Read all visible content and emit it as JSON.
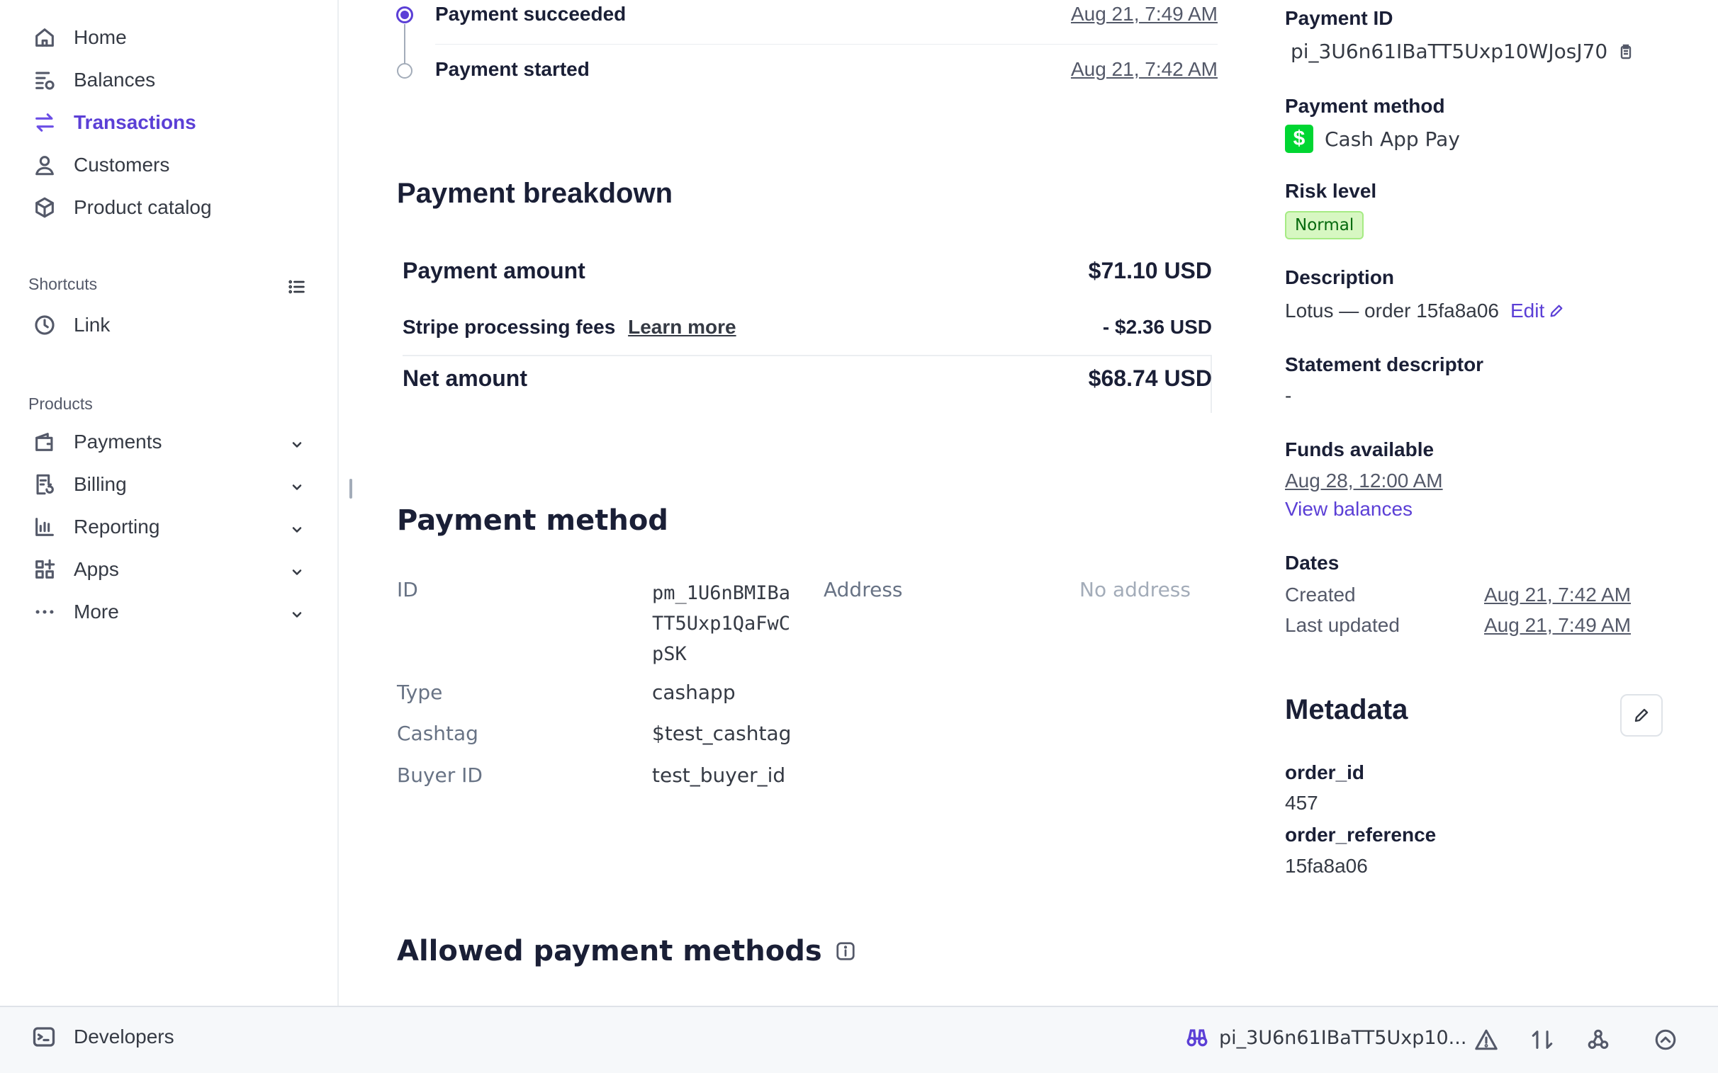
{
  "sidebar": {
    "nav": [
      {
        "label": "Home",
        "icon": "home-icon"
      },
      {
        "label": "Balances",
        "icon": "balances-icon"
      },
      {
        "label": "Transactions",
        "icon": "transactions-icon",
        "active": true
      },
      {
        "label": "Customers",
        "icon": "customers-icon"
      },
      {
        "label": "Product catalog",
        "icon": "product-catalog-icon"
      }
    ],
    "shortcuts_label": "Shortcuts",
    "shortcuts": [
      {
        "label": "Link",
        "icon": "clock-icon"
      }
    ],
    "products_label": "Products",
    "products": [
      {
        "label": "Payments",
        "icon": "wallet-icon"
      },
      {
        "label": "Billing",
        "icon": "billing-icon"
      },
      {
        "label": "Reporting",
        "icon": "bar-chart-icon"
      },
      {
        "label": "Apps",
        "icon": "apps-icon"
      },
      {
        "label": "More",
        "icon": "more-icon"
      }
    ]
  },
  "timeline": [
    {
      "title": "Payment succeeded",
      "date": "Aug 21, 7:49 AM"
    },
    {
      "title": "Payment started",
      "date": "Aug 21, 7:42 AM"
    }
  ],
  "breakdown": {
    "heading": "Payment breakdown",
    "payment_amount_label": "Payment amount",
    "payment_amount": "$71.10 USD",
    "fees_label": "Stripe processing fees",
    "fees_link": "Learn more",
    "fees": "- $2.36 USD",
    "net_label": "Net amount",
    "net": "$68.74 USD"
  },
  "payment_method": {
    "heading": "Payment method",
    "id_label": "ID",
    "id_lines": [
      "pm_1U6nBMIBa",
      "TT5Uxp1QaFwC",
      "pSK"
    ],
    "address_label": "Address",
    "address_value": "No address",
    "type_label": "Type",
    "type_value": "cashapp",
    "cashtag_label": "Cashtag",
    "cashtag_value": "$test_cashtag",
    "buyer_label": "Buyer ID",
    "buyer_value": "test_buyer_id"
  },
  "allowed_heading": "Allowed payment methods",
  "details": {
    "payment_id_label": "Payment ID",
    "payment_id": "pi_3U6n61IBaTT5Uxp10WJosJ70",
    "payment_method_label": "Payment method",
    "payment_method_value": "Cash App Pay",
    "risk_label": "Risk level",
    "risk_value": "Normal",
    "description_label": "Description",
    "description_value": "Lotus — order 15fa8a06",
    "edit_label": "Edit",
    "statement_label": "Statement descriptor",
    "statement_value": "-",
    "funds_label": "Funds available",
    "funds_date": "Aug 28, 12:00 AM",
    "view_balances": "View balances",
    "dates_label": "Dates",
    "created_label": "Created",
    "created_value": "Aug 21, 7:42 AM",
    "updated_label": "Last updated",
    "updated_value": "Aug 21, 7:49 AM"
  },
  "metadata": {
    "heading": "Metadata",
    "items": [
      {
        "key": "order_id",
        "value": "457"
      },
      {
        "key": "order_reference",
        "value": "15fa8a06"
      }
    ]
  },
  "bottombar": {
    "developers_label": "Developers",
    "object_id": "pi_3U6n61IBaTT5Uxp10..."
  },
  "colors": {
    "accent": "#5b3fd6",
    "cashapp": "#00d632",
    "risk_bg": "#d7f7c2",
    "risk_text": "#05690d"
  }
}
